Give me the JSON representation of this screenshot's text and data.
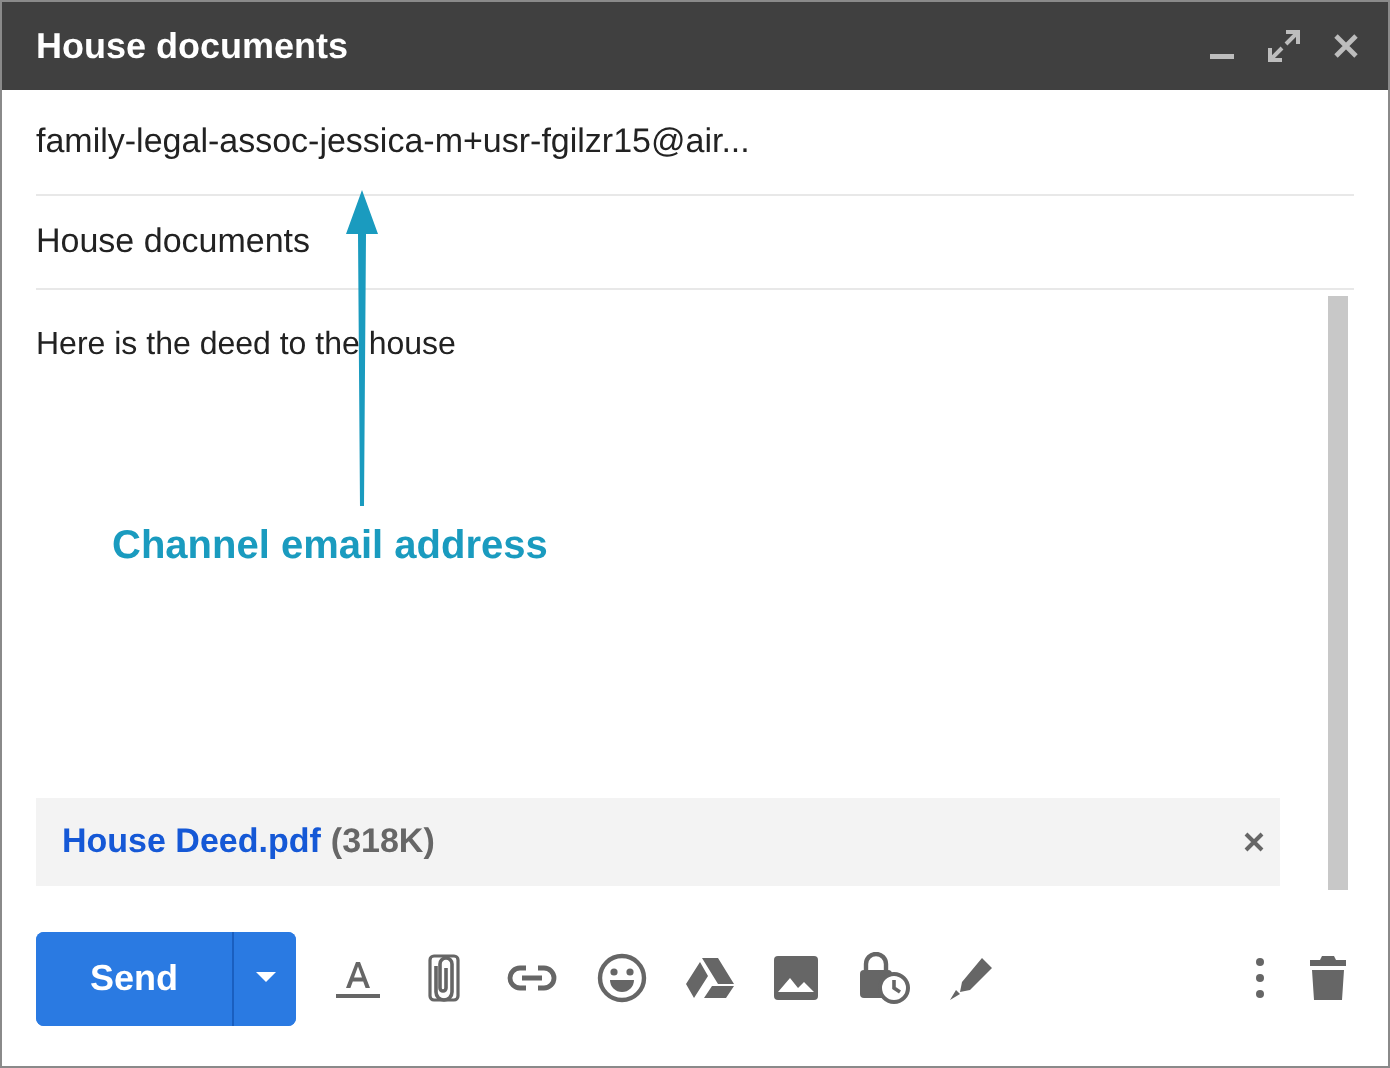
{
  "window": {
    "title": "House documents"
  },
  "to": {
    "value": "family-legal-assoc-jessica-m+usr-fgilzr15@air..."
  },
  "subject": {
    "value": "House documents"
  },
  "body": {
    "text": "Here is the deed to the house"
  },
  "attachment": {
    "name": "House Deed.pdf",
    "size": "(318K)"
  },
  "annotation": {
    "label": "Channel email address"
  },
  "send_button": {
    "label": "Send"
  }
}
